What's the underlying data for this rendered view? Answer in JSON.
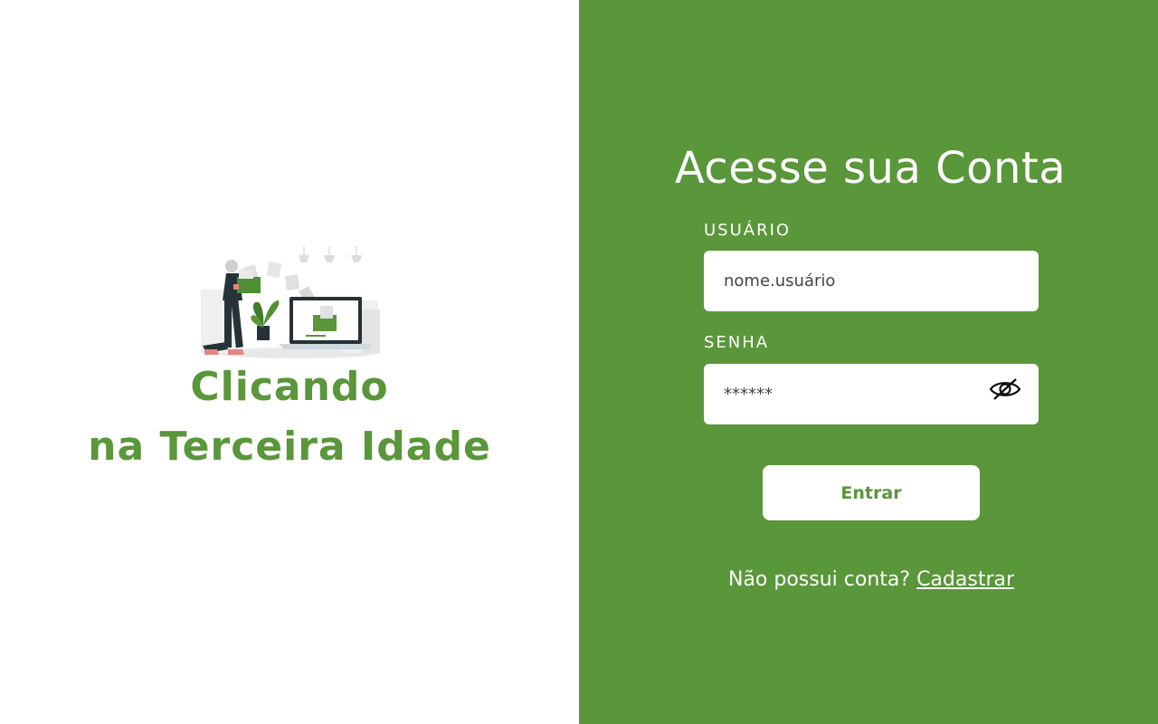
{
  "brand": {
    "line1": "Clicando",
    "line2": "na Terceira Idade"
  },
  "login": {
    "title": "Acesse sua Conta",
    "username_label": "USUÁRIO",
    "username_placeholder": "nome.usuário",
    "password_label": "SENHA",
    "password_placeholder": "******",
    "submit_label": "Entrar",
    "signup_prompt": "Não possui conta?",
    "signup_link": "Cadastrar"
  },
  "colors": {
    "primary_green": "#5a963a",
    "white": "#ffffff"
  },
  "icons": {
    "password_toggle": "eye-slash-icon",
    "illustration": "person-moving-files-to-laptop-illustration"
  }
}
